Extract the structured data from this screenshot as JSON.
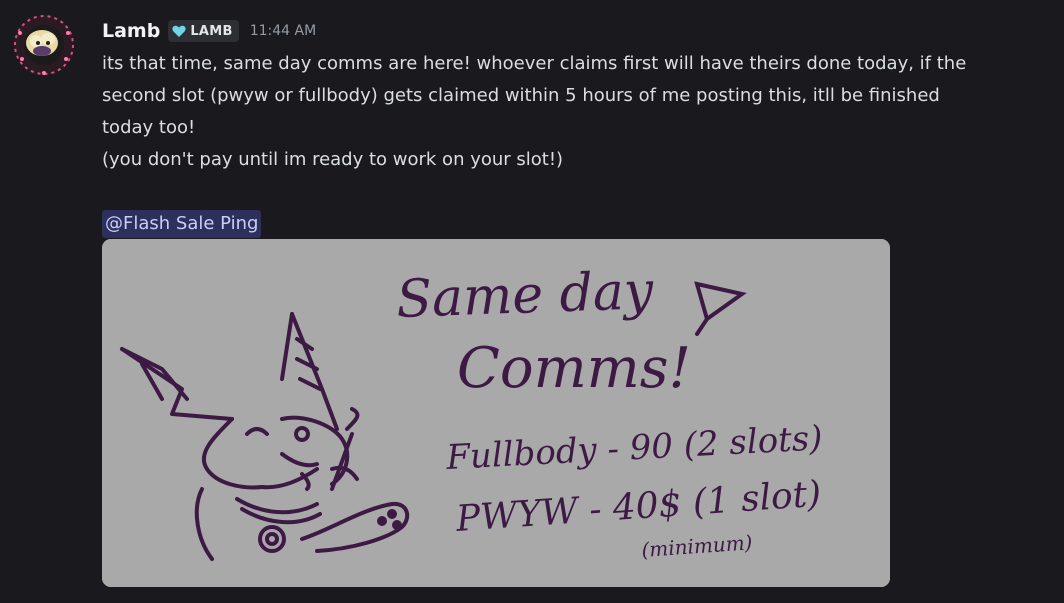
{
  "message": {
    "author": "Lamb",
    "role_tag": "LAMB",
    "role_icon": "heart-icon",
    "role_color": "#6fd6e8",
    "timestamp": "11:44 AM",
    "lines": [
      "its that time, same day comms are here! whoever claims first will have theirs done today, if the",
      "second slot (pwyw or fullbody) gets claimed within 5 hours of me posting this, itll be finished",
      "today too!",
      "(you don't pay until im ready to work on your slot!)"
    ],
    "mention": "@Flash Sale Ping"
  },
  "attachment": {
    "title_line1": "Same day",
    "title_line2": "Comms!",
    "price_line1": "Fullbody - 90 (2 slots)",
    "price_line2": "PWYW - 40$ (1 slot)",
    "price_note": "(minimum)",
    "ink_color": "#3d1a44",
    "background_color": "#a9a9a9"
  }
}
